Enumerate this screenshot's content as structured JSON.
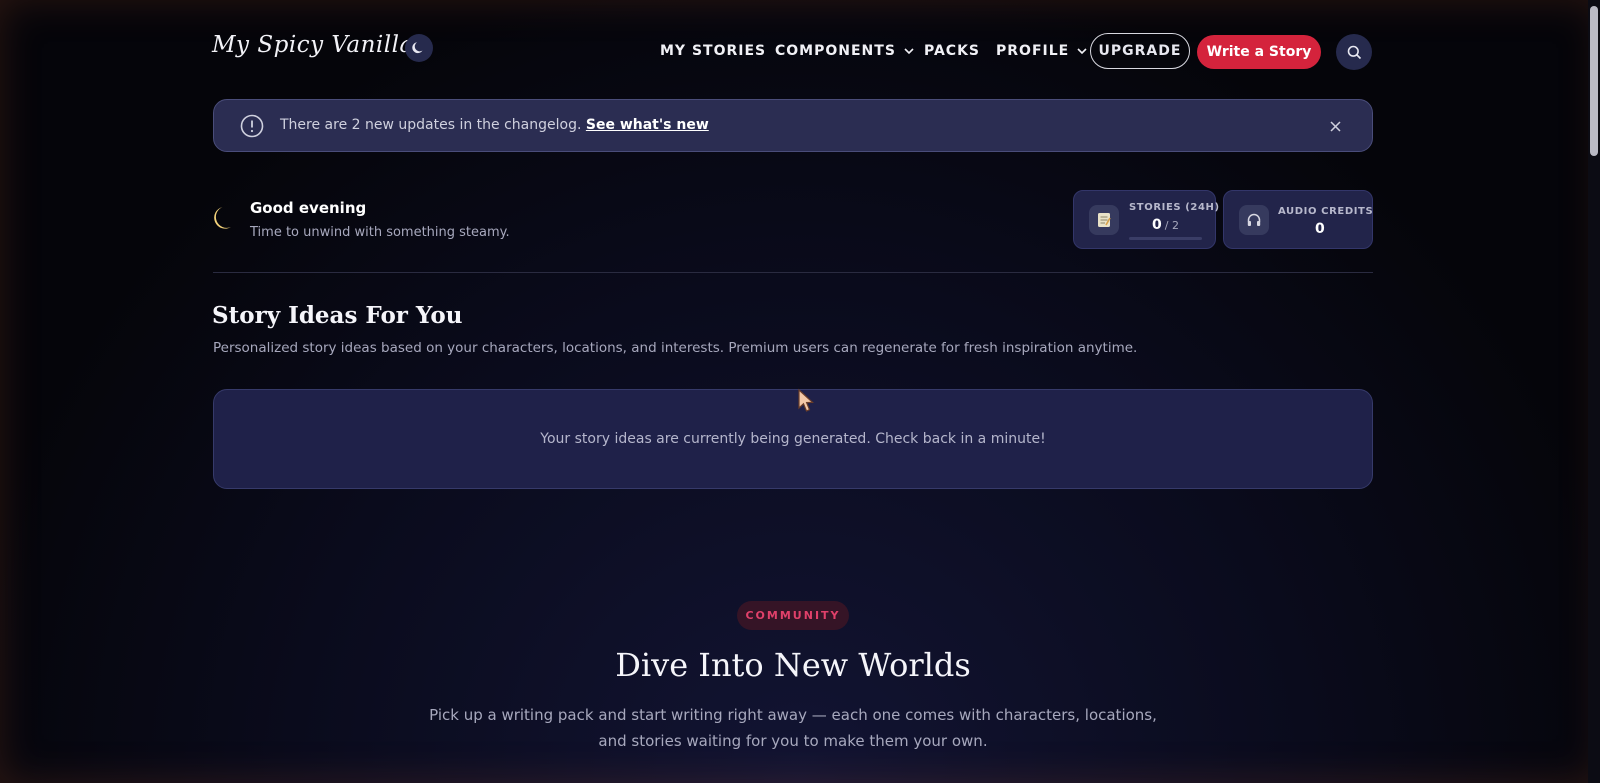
{
  "header": {
    "logo_text": "My Spicy Vanilla",
    "theme_icon": "moon-icon",
    "nav": [
      {
        "label": "MY STORIES",
        "dropdown": false
      },
      {
        "label": "COMPONENTS",
        "dropdown": true
      },
      {
        "label": "PACKS",
        "dropdown": false
      },
      {
        "label": "PROFILE",
        "dropdown": true
      }
    ],
    "upgrade_label": "UPGRADE",
    "write_label": "Write a Story",
    "search_icon": "search-icon"
  },
  "banner": {
    "text": "There are 2 new updates in the changelog.",
    "link": "See what's new",
    "icon": "alert-circle-icon",
    "close_icon": "close-icon"
  },
  "greeting": {
    "title": "Good evening",
    "subtitle": "Time to unwind with something steamy."
  },
  "stats": {
    "stories": {
      "label": "STORIES (24H)",
      "value": "0",
      "max": "/ 2",
      "progress": 0
    },
    "audio": {
      "label": "AUDIO CREDITS",
      "value": "0"
    }
  },
  "ideas": {
    "title": "Story Ideas For You",
    "subtitle": "Personalized story ideas based on your characters, locations, and interests. Premium users can regenerate for fresh inspiration anytime.",
    "message": "Your story ideas are currently being generated. Check back in a minute!"
  },
  "community": {
    "tag": "COMMUNITY",
    "title": "Dive Into New Worlds",
    "subtitle_line1": "Pick up a writing pack and start writing right away — each one comes with characters, locations,",
    "subtitle_line2": "and stories waiting for you to make them your own."
  },
  "colors": {
    "accent": "#d4233c",
    "card": "#22244a",
    "banner": "#2b2d52"
  }
}
